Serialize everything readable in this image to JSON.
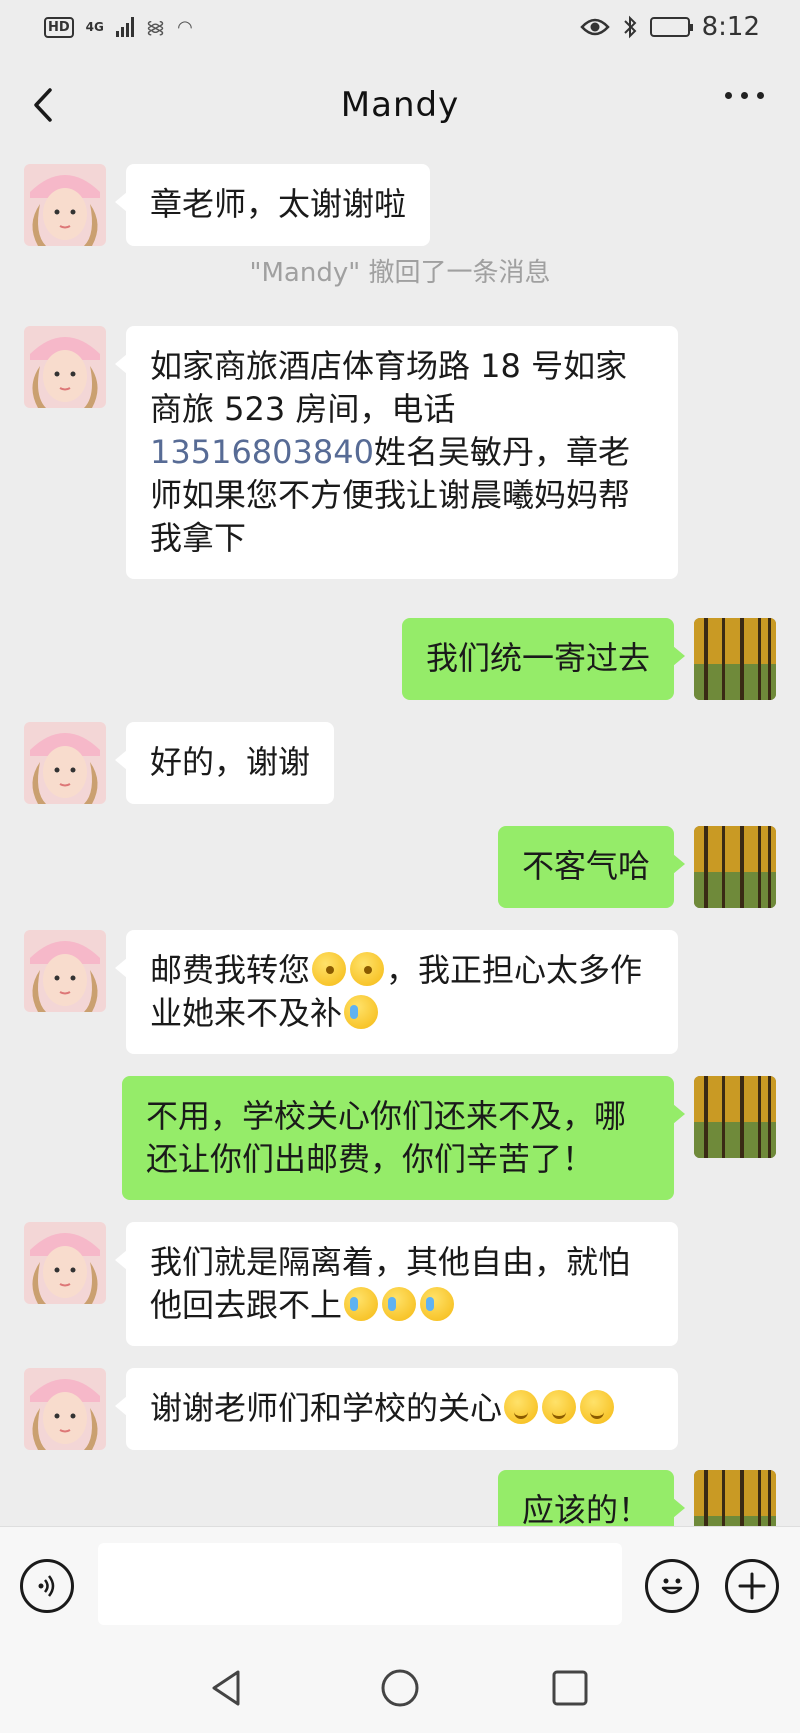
{
  "status_bar": {
    "hd": "HD",
    "network": "4G",
    "time": "8:12",
    "battery_level": 0.8
  },
  "nav": {
    "title": "Mandy"
  },
  "messages": [
    {
      "sender": "Mandy",
      "direction": "in",
      "text": "章老师，太谢谢啦"
    },
    {
      "sender": "Mandy",
      "direction": "in",
      "text_before": "如家商旅酒店体育场路 18 号如家商旅 523 房间，电话",
      "phone": "13516803840",
      "text_after": "姓名吴敏丹，章老师如果您不方便我让谢晨曦妈妈帮我拿下"
    },
    {
      "sender": "me",
      "direction": "out",
      "text": "我们统一寄过去"
    },
    {
      "sender": "Mandy",
      "direction": "in",
      "text": "好的，谢谢"
    },
    {
      "sender": "me",
      "direction": "out",
      "text": "不客气哈"
    },
    {
      "sender": "Mandy",
      "direction": "in",
      "text_a": "邮费我转您",
      "text_b": "，我正担心太多作业她来不及补",
      "emojis": [
        "thinking",
        "thinking",
        "crying"
      ]
    },
    {
      "sender": "me",
      "direction": "out",
      "text": "不用，学校关心你们还来不及，哪还让你们出邮费，你们辛苦了！"
    },
    {
      "sender": "Mandy",
      "direction": "in",
      "text": "我们就是隔离着，其他自由，就怕他回去跟不上",
      "emojis": [
        "crying",
        "crying",
        "crying"
      ]
    },
    {
      "sender": "Mandy",
      "direction": "in",
      "text": "谢谢老师们和学校的关心",
      "emojis": [
        "smile",
        "smile",
        "smile"
      ]
    },
    {
      "sender": "me",
      "direction": "out",
      "text": "应该的！"
    }
  ],
  "system_notice": "\"Mandy\" 撤回了一条消息",
  "input": {
    "value": "",
    "placeholder": ""
  },
  "icons": {
    "back": "chevron-left-icon",
    "more": "more-dots-icon",
    "voice": "voice-icon",
    "emoji": "emoji-face-icon",
    "plus": "plus-icon",
    "sys_back": "triangle-back-icon",
    "sys_home": "circle-home-icon",
    "sys_recent": "square-recent-icon"
  },
  "colors": {
    "background": "#ededed",
    "incoming_bubble": "#ffffff",
    "outgoing_bubble": "#95ec69",
    "link": "#576b95",
    "system_text": "#a0a0a0"
  }
}
